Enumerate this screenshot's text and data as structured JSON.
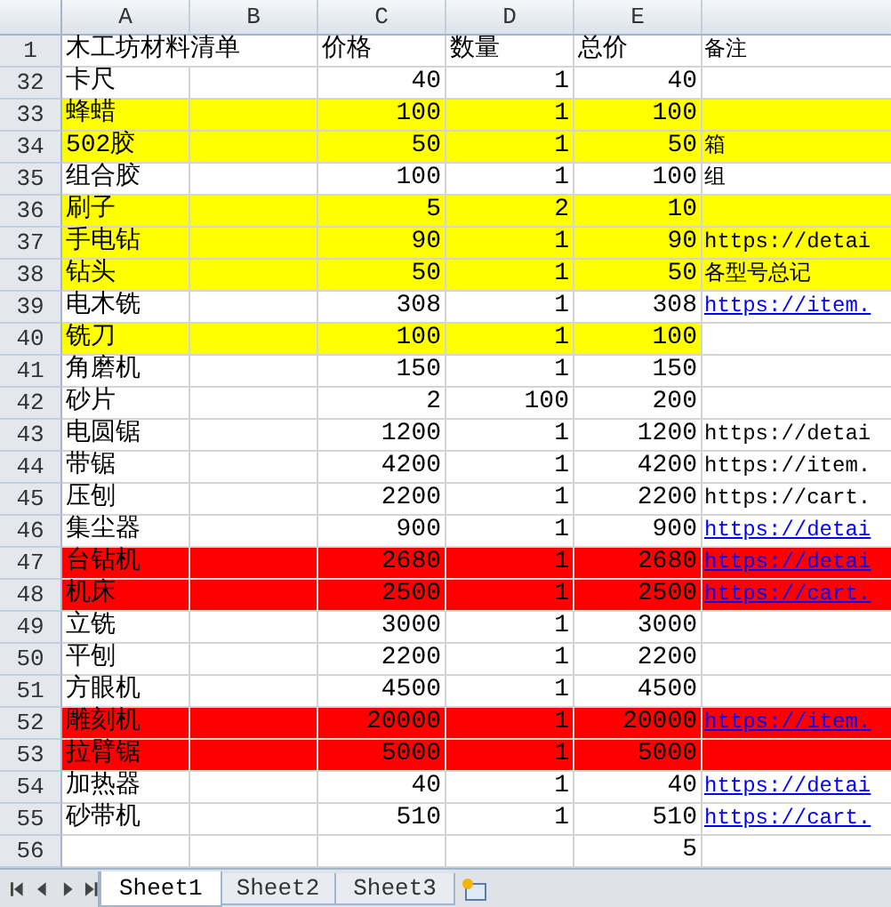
{
  "columns": [
    "A",
    "B",
    "C",
    "D",
    "E"
  ],
  "header_row": {
    "number": "1",
    "title": "木工坊材料清单",
    "price": "价格",
    "qty": "数量",
    "total": "总价",
    "notes": "备注"
  },
  "rows": [
    {
      "number": "32",
      "item": "卡尺",
      "price": "40",
      "qty": "1",
      "total": "40"
    },
    {
      "number": "33",
      "item": "蜂蜡",
      "price": "100",
      "qty": "1",
      "total": "100",
      "color": "#ffff00",
      "fill_notes": true
    },
    {
      "number": "34",
      "item": "502胶",
      "price": "50",
      "qty": "1",
      "total": "50",
      "note": {
        "kind": "text",
        "text": "箱"
      },
      "color": "#ffff00",
      "fill_notes": true
    },
    {
      "number": "35",
      "item": "组合胶",
      "price": "100",
      "qty": "1",
      "total": "100",
      "note": {
        "kind": "text",
        "text": "组"
      }
    },
    {
      "number": "36",
      "item": "刷子",
      "price": "5",
      "qty": "2",
      "total": "10",
      "color": "#ffff00",
      "fill_notes": true
    },
    {
      "number": "37",
      "item": "手电钻",
      "price": "90",
      "qty": "1",
      "total": "90",
      "note": {
        "kind": "text",
        "text": "https://detai"
      },
      "color": "#ffff00",
      "fill_notes": true
    },
    {
      "number": "38",
      "item": "钻头",
      "price": "50",
      "qty": "1",
      "total": "50",
      "note": {
        "kind": "text",
        "text": "各型号总记"
      },
      "color": "#ffff00",
      "fill_notes": true
    },
    {
      "number": "39",
      "item": "电木铣",
      "price": "308",
      "qty": "1",
      "total": "308",
      "note": {
        "kind": "link",
        "text": "https://item."
      }
    },
    {
      "number": "40",
      "item": "铣刀",
      "price": "100",
      "qty": "1",
      "total": "100",
      "color": "#ffff00",
      "fill_notes": false
    },
    {
      "number": "41",
      "item": "角磨机",
      "price": "150",
      "qty": "1",
      "total": "150"
    },
    {
      "number": "42",
      "item": "砂片",
      "price": "2",
      "qty": "100",
      "total": "200"
    },
    {
      "number": "43",
      "item": "电圆锯",
      "price": "1200",
      "qty": "1",
      "total": "1200",
      "note": {
        "kind": "text",
        "text": "https://detai"
      }
    },
    {
      "number": "44",
      "item": "带锯",
      "price": "4200",
      "qty": "1",
      "total": "4200",
      "note": {
        "kind": "text",
        "text": "https://item."
      }
    },
    {
      "number": "45",
      "item": "压刨",
      "price": "2200",
      "qty": "1",
      "total": "2200",
      "note": {
        "kind": "text",
        "text": "https://cart."
      }
    },
    {
      "number": "46",
      "item": "集尘器",
      "price": "900",
      "qty": "1",
      "total": "900",
      "note": {
        "kind": "link",
        "text": "https://detai"
      }
    },
    {
      "number": "47",
      "item": "台钻机",
      "price": "2680",
      "qty": "1",
      "total": "2680",
      "note": {
        "kind": "link",
        "text": "https://detai"
      },
      "color": "#ff0000",
      "fill_notes": true
    },
    {
      "number": "48",
      "item": "机床",
      "price": "2500",
      "qty": "1",
      "total": "2500",
      "note": {
        "kind": "link",
        "text": "https://cart."
      },
      "color": "#ff0000",
      "fill_notes": true
    },
    {
      "number": "49",
      "item": "立铣",
      "price": "3000",
      "qty": "1",
      "total": "3000"
    },
    {
      "number": "50",
      "item": "平刨",
      "price": "2200",
      "qty": "1",
      "total": "2200"
    },
    {
      "number": "51",
      "item": "方眼机",
      "price": "4500",
      "qty": "1",
      "total": "4500"
    },
    {
      "number": "52",
      "item": "雕刻机",
      "price": "20000",
      "qty": "1",
      "total": "20000",
      "note": {
        "kind": "link",
        "text": "https://item."
      },
      "color": "#ff0000",
      "fill_notes": true
    },
    {
      "number": "53",
      "item": "拉臂锯",
      "price": "5000",
      "qty": "1",
      "total": "5000",
      "color": "#ff0000",
      "fill_notes": true
    },
    {
      "number": "54",
      "item": "加热器",
      "price": "40",
      "qty": "1",
      "total": "40",
      "note": {
        "kind": "link",
        "text": "https://detai"
      }
    },
    {
      "number": "55",
      "item": "砂带机",
      "price": "510",
      "qty": "1",
      "total": "510",
      "note": {
        "kind": "link",
        "text": "https://cart."
      }
    },
    {
      "number": "56",
      "total": "5"
    }
  ],
  "sheet_tabs": [
    {
      "label": "Sheet1",
      "selected": true
    },
    {
      "label": "Sheet2",
      "selected": false
    },
    {
      "label": "Sheet3",
      "selected": false
    }
  ]
}
